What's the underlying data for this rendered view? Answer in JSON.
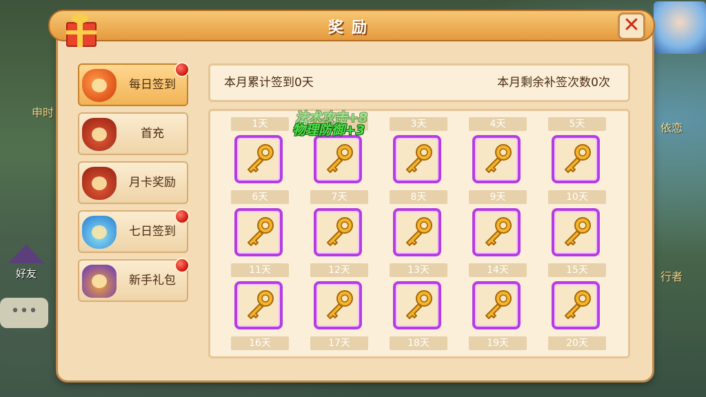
{
  "background": {
    "left_text_1": "申时",
    "right_text_1": "依恋",
    "right_text_2": "行者",
    "friend_label": "好友",
    "chat_icon": "speech-bubble-icon"
  },
  "dialog": {
    "title": "奖励",
    "title_icon": "gift-icon",
    "close_icon": "close-icon"
  },
  "menu": [
    {
      "label": "每日签到",
      "icon": "coin-bag-icon",
      "active": true,
      "badge": true
    },
    {
      "label": "首充",
      "icon": "money-bag-icon",
      "active": false,
      "badge": false
    },
    {
      "label": "月卡奖励",
      "icon": "money-bag-icon",
      "active": false,
      "badge": false
    },
    {
      "label": "七日签到",
      "icon": "blue-bag-icon",
      "active": false,
      "badge": true
    },
    {
      "label": "新手礼包",
      "icon": "gift-pack-icon",
      "active": false,
      "badge": true
    }
  ],
  "info": {
    "left": "本月累计签到0天",
    "right": "本月剩余补签次数0次"
  },
  "days": [
    "1天",
    "2天",
    "3天",
    "4天",
    "5天",
    "6天",
    "7天",
    "8天",
    "9天",
    "10天",
    "11天",
    "12天",
    "13天",
    "14天",
    "15天",
    "16天",
    "17天",
    "18天",
    "19天",
    "20天"
  ],
  "reward_icon": "golden-key-icon",
  "floating": {
    "ghost": "法术攻击+8",
    "main": "物理防御+3"
  },
  "colors": {
    "accent": "#e59b3e",
    "cell_border": "#b53ce2",
    "badge": "#d0140a",
    "float_green": "#4ee04a"
  }
}
